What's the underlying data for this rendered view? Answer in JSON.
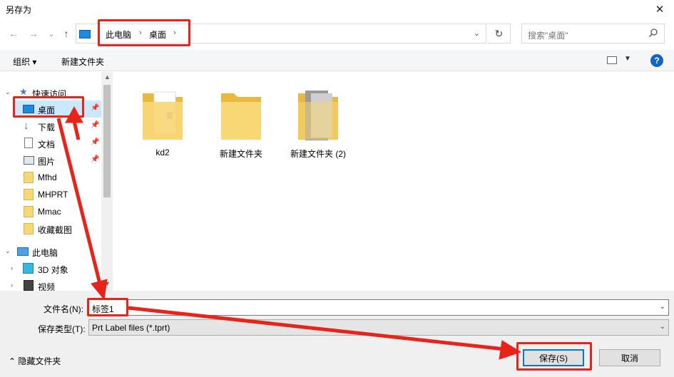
{
  "window": {
    "title": "另存为",
    "close_glyph": "✕"
  },
  "nav": {
    "back_glyph": "←",
    "forward_glyph": "→",
    "recent_glyph": "⌄",
    "up_glyph": "↑",
    "breadcrumbs": [
      "此电脑",
      "桌面"
    ],
    "refresh_glyph": "↻",
    "search_placeholder": "搜索\"桌面\""
  },
  "toolbar": {
    "organize_label": "组织 ▾",
    "new_folder_label": "新建文件夹",
    "help_glyph": "?"
  },
  "sidebar": {
    "quick_access_label": "快速访问",
    "items": [
      {
        "label": "桌面",
        "icon": "desktop-icon",
        "pinned": true,
        "selected": true
      },
      {
        "label": "下载",
        "icon": "download-icon",
        "pinned": true
      },
      {
        "label": "文档",
        "icon": "document-icon",
        "pinned": true
      },
      {
        "label": "图片",
        "icon": "picture-icon",
        "pinned": true
      },
      {
        "label": "Mfhd",
        "icon": "folder-icon"
      },
      {
        "label": "MHPRT",
        "icon": "folder-icon"
      },
      {
        "label": "Mmac",
        "icon": "folder-icon"
      },
      {
        "label": "收藏截图",
        "icon": "folder-icon"
      }
    ],
    "this_pc_label": "此电脑",
    "pc_items": [
      {
        "label": "3D 对象",
        "icon": "cube-icon"
      },
      {
        "label": "视频",
        "icon": "video-icon"
      }
    ]
  },
  "content": {
    "items": [
      {
        "label": "kd2",
        "icon": "folder-icon"
      },
      {
        "label": "新建文件夹",
        "icon": "folder-icon"
      },
      {
        "label": "新建文件夹 (2)",
        "icon": "folder-icon"
      }
    ]
  },
  "form": {
    "filename_label": "文件名(N):",
    "filename_value": "标签1",
    "filetype_label": "保存类型(T):",
    "filetype_value": "Prt Label files (*.tprt)",
    "hide_folders_label": "隐藏文件夹",
    "save_label": "保存(S)",
    "cancel_label": "取消"
  },
  "colors": {
    "annotation": "#e8231a",
    "selection": "#cce8ff",
    "accent": "#0078d7"
  }
}
